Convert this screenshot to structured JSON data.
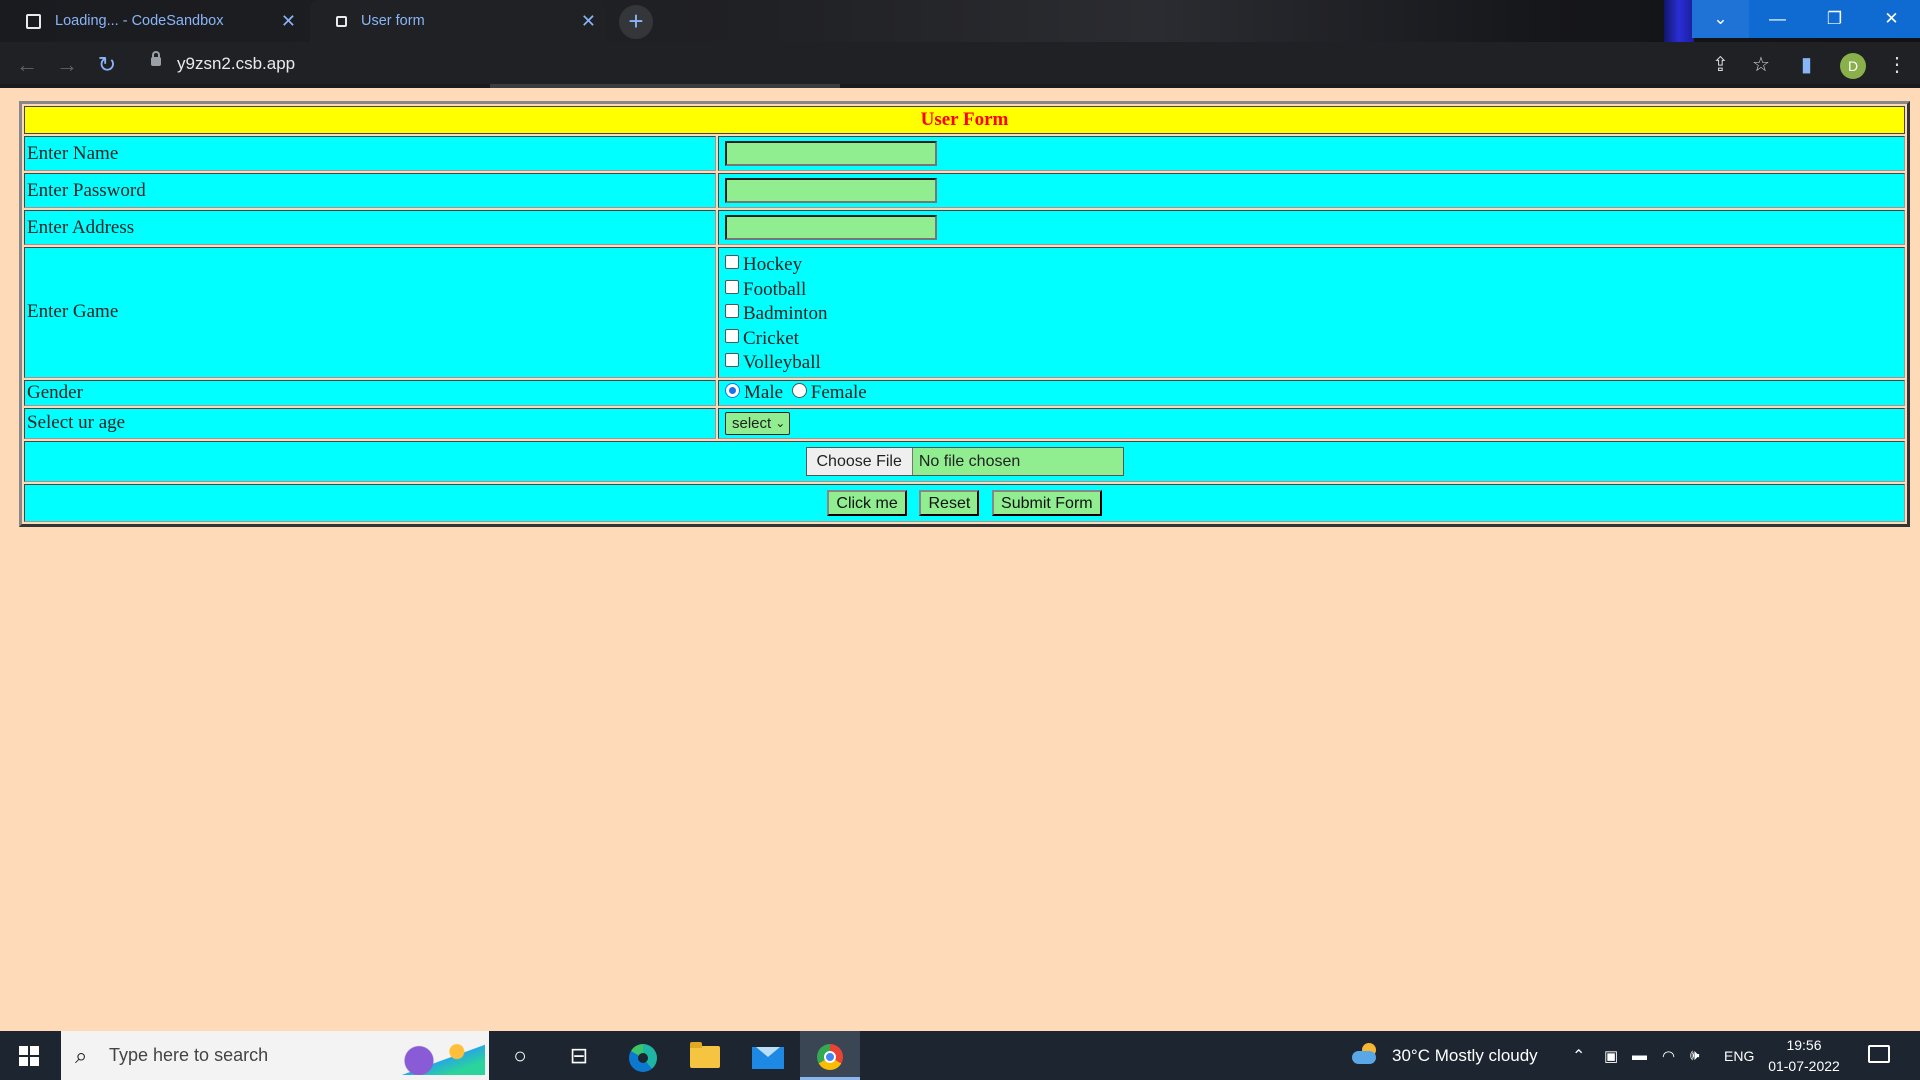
{
  "browser": {
    "tabs": [
      {
        "title": "Loading... - CodeSandbox",
        "active": false
      },
      {
        "title": "User form",
        "active": true
      }
    ],
    "new_tab": "+",
    "url": "y9zsn2.csb.app",
    "profile_initial": "D",
    "controls": {
      "tab_search": "⌄",
      "minimize": "—",
      "restore": "❐",
      "close": "✕"
    }
  },
  "form": {
    "title": "User Form",
    "name_label": "Enter Name",
    "password_label": "Enter Password",
    "address_label": "Enter Address",
    "game_label": "Enter Game",
    "games": [
      "Hockey",
      "Football",
      "Badminton",
      "Cricket",
      "Volleyball"
    ],
    "gender_label": "Gender",
    "gender_options": [
      {
        "label": "Male",
        "selected": true
      },
      {
        "label": "Female",
        "selected": false
      }
    ],
    "age_label": "Select ur age",
    "age_select_value": "select",
    "file_button": "Choose File",
    "file_status": "No file chosen",
    "buttons": {
      "click": "Click me",
      "reset": "Reset",
      "submit": "Submit Form"
    }
  },
  "colors": {
    "page_bg": "#ffdab9",
    "cell_bg": "#00ffff",
    "title_bg": "#ffff00",
    "title_text": "#ff0000",
    "input_bg": "#90ee90"
  },
  "taskbar": {
    "search_placeholder": "Type here to search",
    "weather": "30°C  Mostly cloudy",
    "language": "ENG",
    "time": "19:56",
    "date": "01-07-2022"
  }
}
